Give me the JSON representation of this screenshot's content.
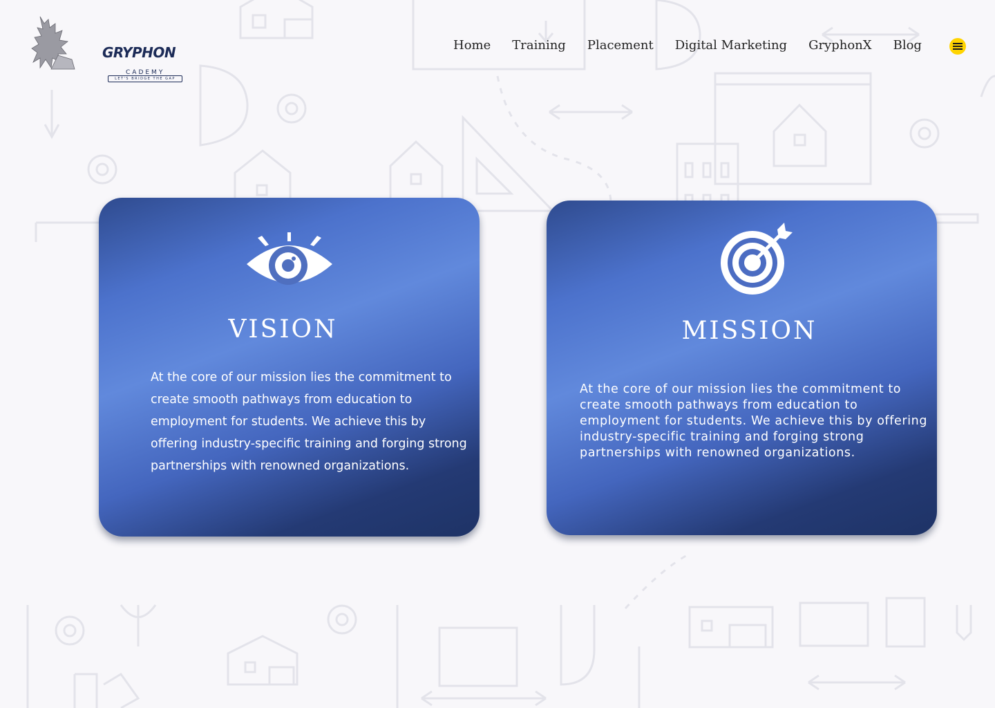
{
  "brand": {
    "name": "GRYPHON",
    "sub": "CADEMY",
    "tagline": "LET'S BRIDGE THE GAP"
  },
  "nav": {
    "items": [
      "Home",
      "Training",
      "Placement",
      "Digital Marketing",
      "GryphonX",
      "Blog"
    ],
    "menu_icon": "hamburger-icon",
    "menu_color": "#ffd400"
  },
  "vision": {
    "title": "VISION",
    "icon": "eye-icon",
    "text": "At the core of our mission lies the commitment to create smooth pathways from education to employment  for students. We achieve this by offering industry-specific  training and forging strong partnerships with renowned  organizations."
  },
  "mission": {
    "title": "MISSION",
    "icon": "target-icon",
    "text": "At the core of our mission lies the commitment to create smooth pathways from education to employment  for students. We achieve this by offering industry-specific  training and forging strong partnerships with renowned  organizations."
  },
  "colors": {
    "card_gradient_dark": "#1e3366",
    "card_gradient_light": "#6189dc",
    "background": "#f8f7fa",
    "text_dark": "#222222"
  }
}
